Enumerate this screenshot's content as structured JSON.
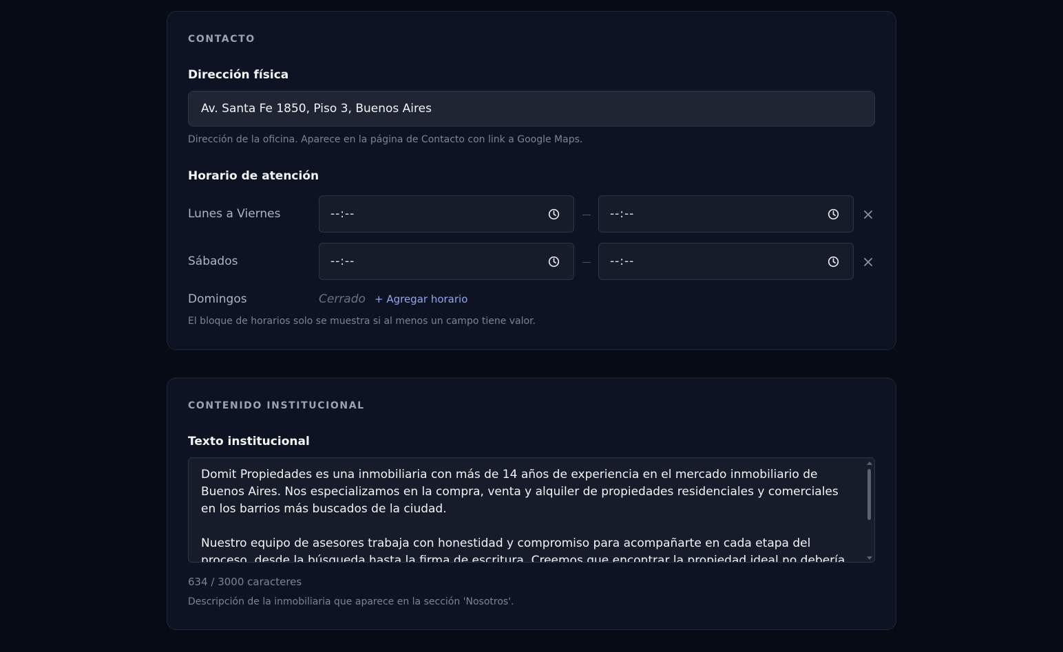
{
  "contact": {
    "section_title": "CONTACTO",
    "address_label": "Dirección física",
    "address_value": "Av. Santa Fe 1850, Piso 3, Buenos Aires",
    "address_help": "Dirección de la oficina. Aparece en la página de Contacto con link a Google Maps.",
    "hours_label": "Horario de atención",
    "days": [
      {
        "label": "Lunes a Viernes",
        "from": "--:--",
        "to": "--:--"
      },
      {
        "label": "Sábados",
        "from": "--:--",
        "to": "--:--"
      },
      {
        "label": "Domingos",
        "status": "Cerrado",
        "add_label": "+ Agregar horario"
      }
    ],
    "hours_help": "El bloque de horarios solo se muestra si al menos un campo tiene valor."
  },
  "institutional": {
    "section_title": "CONTENIDO INSTITUCIONAL",
    "text_label": "Texto institucional",
    "text_value": "Domit Propiedades es una inmobiliaria con más de 14 años de experiencia en el mercado inmobiliario de Buenos Aires. Nos especializamos en la compra, venta y alquiler de propiedades residenciales y comerciales en los barrios más buscados de la ciudad.\n\nNuestro equipo de asesores trabaja con honestidad y compromiso para acompañarte en cada etapa del proceso, desde la búsqueda hasta la firma de escritura. Creemos que encontrar la propiedad ideal no debería ser complicado.",
    "char_count": "634 / 3000 caracteres",
    "text_help": "Descripción de la inmobiliaria que aparece en la sección 'Nosotros'."
  },
  "icons": {
    "clock": "clock-icon",
    "remove": "close-icon"
  },
  "colors": {
    "background": "#070b16",
    "card": "#0d1322",
    "link": "#93a5ef"
  }
}
